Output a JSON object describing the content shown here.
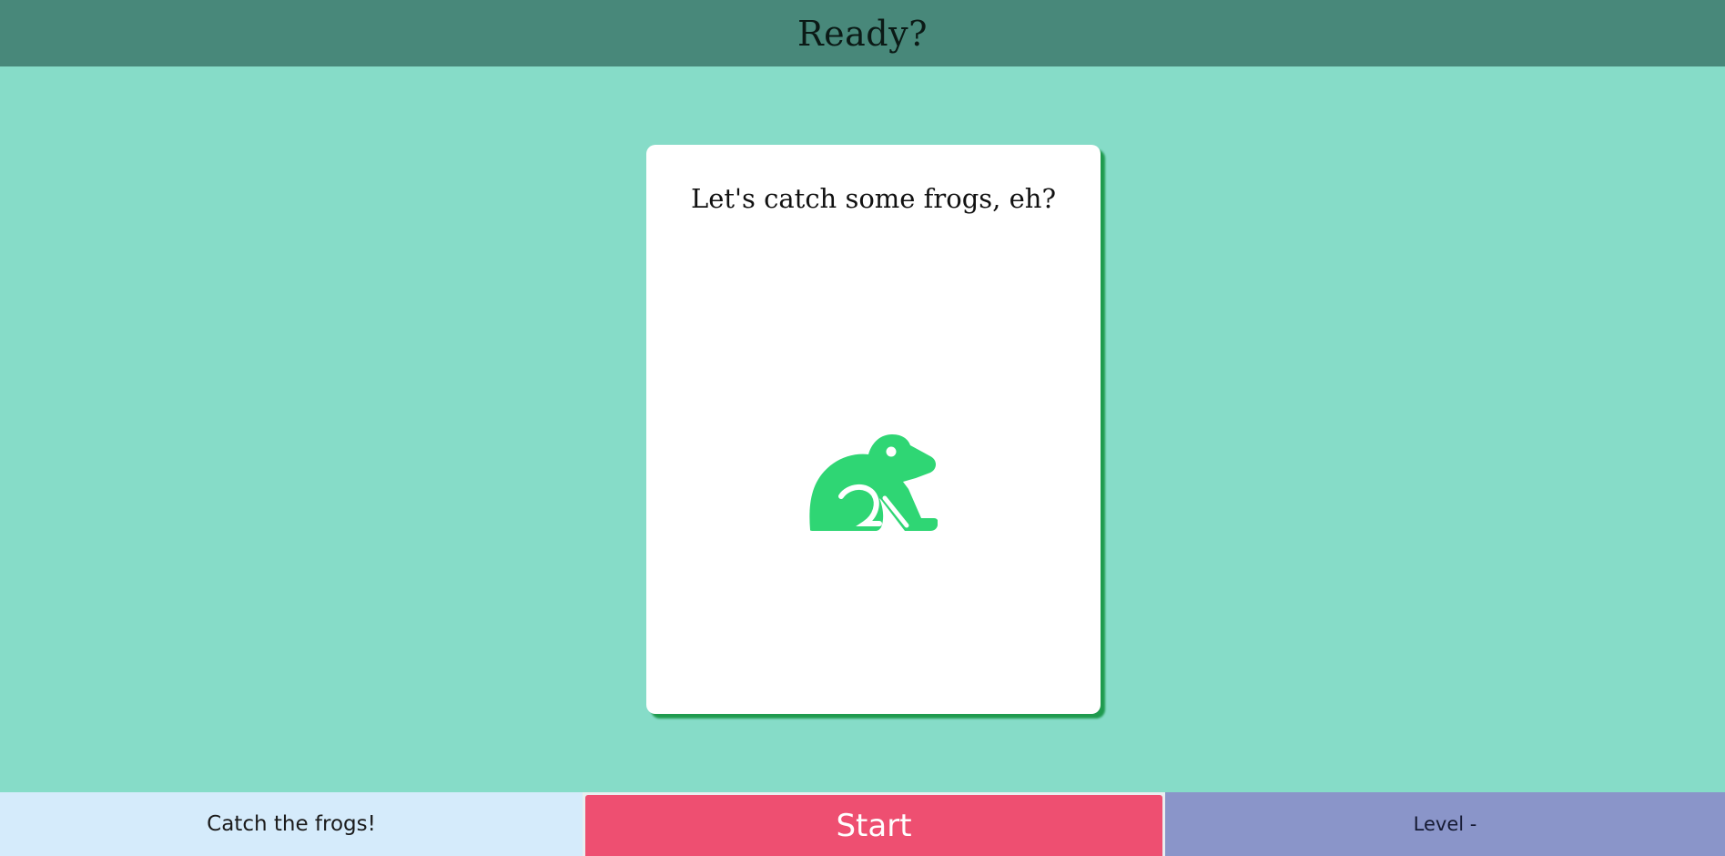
{
  "header": {
    "title": "Ready?"
  },
  "card": {
    "message": "Let's catch some frogs, eh?",
    "icon": "frog-icon"
  },
  "footer": {
    "left_label": "Catch the frogs!",
    "start_label": "Start",
    "level_label": "Level -"
  },
  "colors": {
    "header_bg": "#48887a",
    "page_bg": "#86dcc8",
    "frog": "#2fd674",
    "start_button": "#ee4f71",
    "footer_left_bg": "#d5ebfb",
    "footer_right_bg": "#8a95c9"
  }
}
